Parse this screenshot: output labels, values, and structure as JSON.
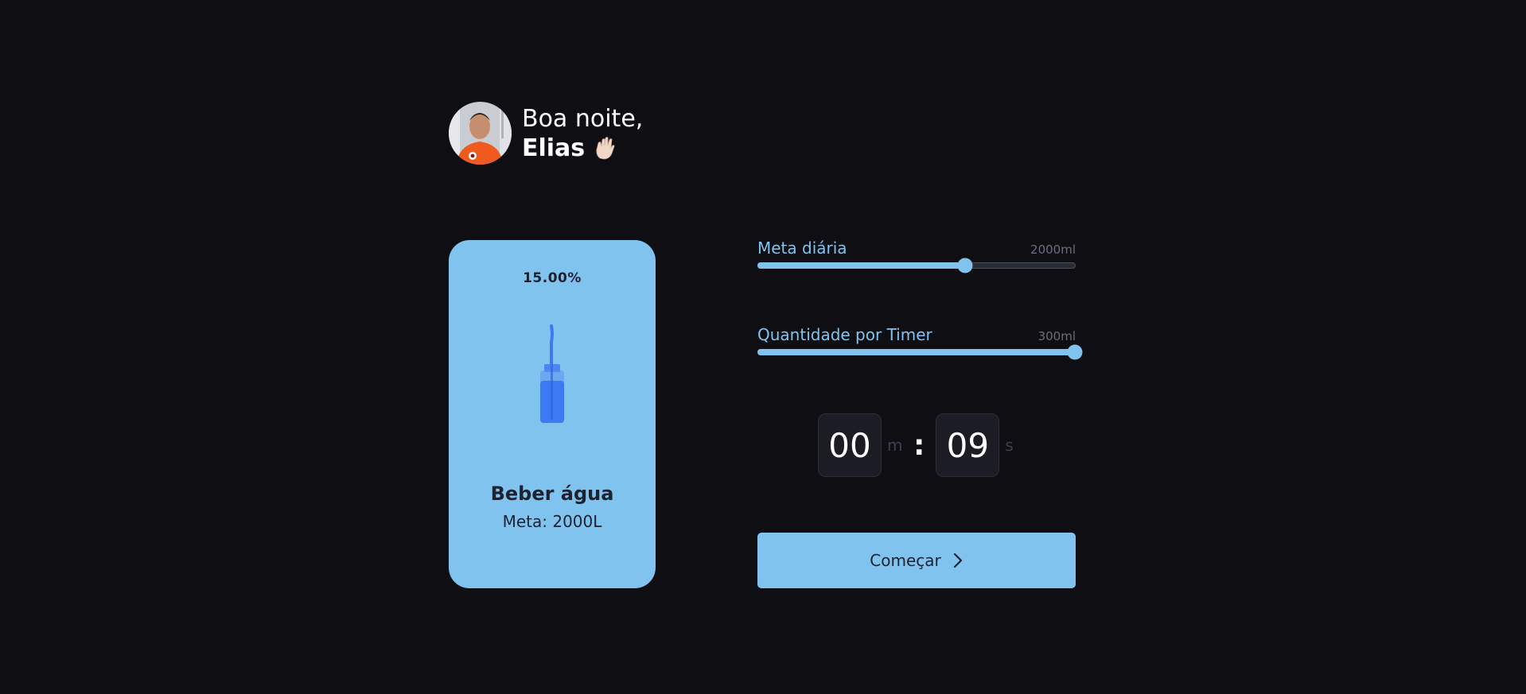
{
  "header": {
    "greeting": "Boa noite,",
    "name": "Elias",
    "wave_icon": "waving-hand-icon",
    "avatar_icon": "user-avatar"
  },
  "card": {
    "percent": "15.00%",
    "progress": 0.15,
    "title": "Beber água",
    "subtitle": "Meta: 2000L",
    "bottle_icon": "water-bottle-icon",
    "color": "#80c3ef"
  },
  "sliders": {
    "daily_goal": {
      "label": "Meta diária",
      "value_text": "2000ml",
      "fraction": 0.654
    },
    "per_timer": {
      "label": "Quantidade por Timer",
      "value_text": "300ml",
      "fraction": 1.0
    }
  },
  "timer": {
    "minutes": "00",
    "minutes_unit": "m",
    "separator": ":",
    "seconds": "09",
    "seconds_unit": "s"
  },
  "start_button": {
    "label": "Começar",
    "icon": "chevron-right-icon"
  },
  "colors": {
    "background": "#0f0f13",
    "accent": "#80c3ef",
    "bottle": "#3b7af5"
  }
}
